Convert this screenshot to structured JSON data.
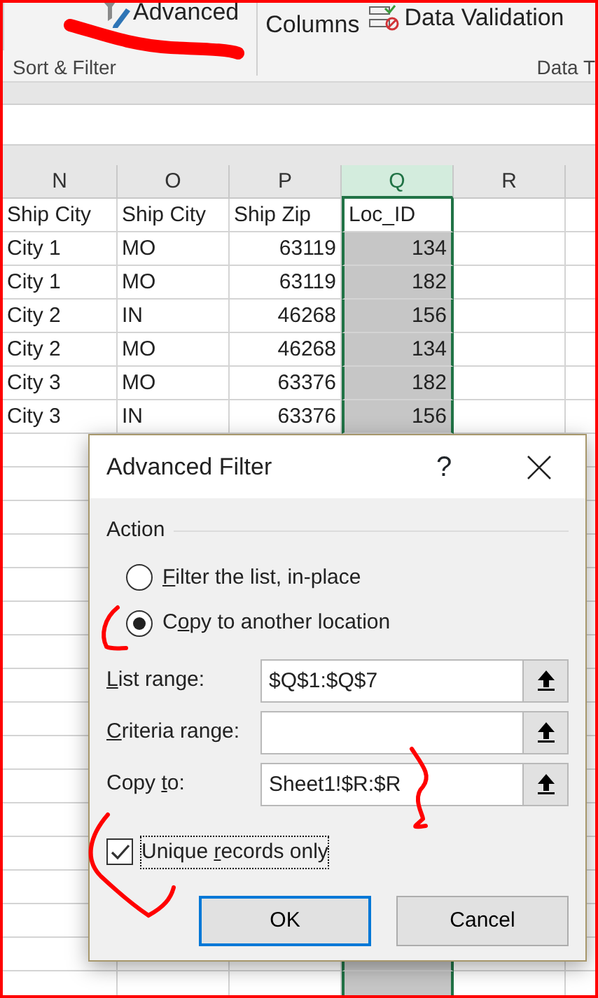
{
  "ribbon": {
    "items": [
      {
        "kind": "filter",
        "label": "Advanced"
      },
      {
        "kind": "plain",
        "label": "Columns"
      },
      {
        "kind": "validation",
        "label": "Data Validation"
      }
    ],
    "groups": [
      "Sort & Filter",
      "Data T"
    ]
  },
  "sheet": {
    "columns": [
      {
        "label": "N",
        "kind": "text",
        "selected": false
      },
      {
        "label": "O",
        "kind": "text",
        "selected": false
      },
      {
        "label": "P",
        "kind": "number",
        "selected": false
      },
      {
        "label": "Q",
        "kind": "number",
        "selected": true
      },
      {
        "label": "R",
        "kind": "text",
        "selected": false
      }
    ],
    "rows": [
      {
        "kind": "header",
        "cells": [
          "Ship City",
          "Ship City",
          "Ship Zip",
          "Loc_ID",
          ""
        ]
      },
      {
        "kind": "data",
        "cells": [
          "City 1",
          "MO",
          "63119",
          "134",
          ""
        ]
      },
      {
        "kind": "data",
        "cells": [
          "City 1",
          "MO",
          "63119",
          "182",
          ""
        ]
      },
      {
        "kind": "data",
        "cells": [
          "City 2",
          "IN",
          "46268",
          "156",
          ""
        ]
      },
      {
        "kind": "data",
        "cells": [
          "City 2",
          "MO",
          "46268",
          "134",
          ""
        ]
      },
      {
        "kind": "data",
        "cells": [
          "City 3",
          "MO",
          "63376",
          "182",
          ""
        ]
      },
      {
        "kind": "data",
        "cells": [
          "City 3",
          "IN",
          "63376",
          "156",
          ""
        ]
      }
    ]
  },
  "dialog": {
    "title": "Advanced Filter",
    "help": "?",
    "group": "Action",
    "radios": [
      {
        "key": "F",
        "after": "ilter the list, in-place",
        "selected": false
      },
      {
        "before": "C",
        "key": "o",
        "after": "py to another location",
        "selected": true
      }
    ],
    "fields": [
      {
        "key": "L",
        "after": "ist range:",
        "value": "$Q$1:$Q$7"
      },
      {
        "key": "C",
        "after": "riteria range:"
      },
      {
        "before": "Copy ",
        "key": "t",
        "after": "o:",
        "value": "Sheet1!$R:$R"
      }
    ],
    "checkbox": {
      "before": "Unique ",
      "key": "r",
      "after": "ecords only",
      "checked": true,
      "focused": true
    },
    "buttons": [
      {
        "label": "OK",
        "default": true
      },
      {
        "label": "Cancel",
        "default": false
      }
    ]
  }
}
